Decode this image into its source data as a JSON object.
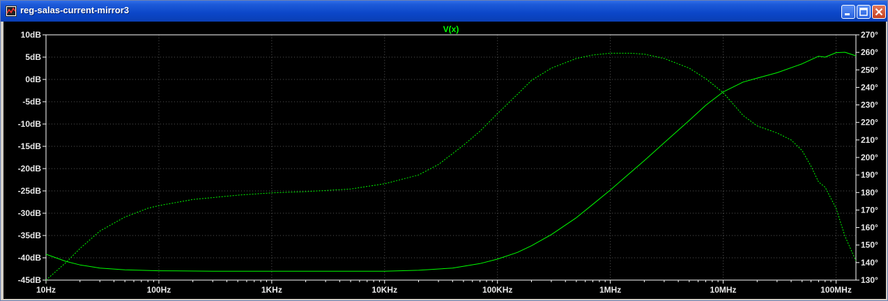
{
  "window": {
    "title": "reg-salas-current-mirror3",
    "icon": "waveform-icon",
    "buttons": [
      "minimize-icon",
      "maximize-icon",
      "close-icon"
    ]
  },
  "colors": {
    "trace": "#00ff00",
    "background": "#000000",
    "axis": "#ffffff",
    "grid": "#555555"
  },
  "chart_data": {
    "type": "line",
    "legend": "V(x)",
    "x_scale": "log",
    "xlim": [
      10,
      150000000
    ],
    "x_ticks": [
      {
        "value": 10,
        "label": "10Hz"
      },
      {
        "value": 100,
        "label": "100Hz"
      },
      {
        "value": 1000,
        "label": "1KHz"
      },
      {
        "value": 10000,
        "label": "10KHz"
      },
      {
        "value": 100000,
        "label": "100KHz"
      },
      {
        "value": 1000000,
        "label": "1MHz"
      },
      {
        "value": 10000000,
        "label": "10MHz"
      },
      {
        "value": 100000000,
        "label": "100MHz"
      }
    ],
    "y_left": {
      "ylim": [
        -45,
        10
      ],
      "ticks": [
        {
          "value": 10,
          "label": "10dB"
        },
        {
          "value": 5,
          "label": "5dB"
        },
        {
          "value": 0,
          "label": "0dB"
        },
        {
          "value": -5,
          "label": "-5dB"
        },
        {
          "value": -10,
          "label": "-10dB"
        },
        {
          "value": -15,
          "label": "-15dB"
        },
        {
          "value": -20,
          "label": "-20dB"
        },
        {
          "value": -25,
          "label": "-25dB"
        },
        {
          "value": -30,
          "label": "-30dB"
        },
        {
          "value": -35,
          "label": "-35dB"
        },
        {
          "value": -40,
          "label": "-40dB"
        },
        {
          "value": -45,
          "label": "-45dB"
        }
      ]
    },
    "y_right": {
      "ylim": [
        130,
        270
      ],
      "ticks": [
        {
          "value": 270,
          "label": "270°"
        },
        {
          "value": 260,
          "label": "260°"
        },
        {
          "value": 250,
          "label": "250°"
        },
        {
          "value": 240,
          "label": "240°"
        },
        {
          "value": 230,
          "label": "230°"
        },
        {
          "value": 220,
          "label": "220°"
        },
        {
          "value": 210,
          "label": "210°"
        },
        {
          "value": 200,
          "label": "200°"
        },
        {
          "value": 190,
          "label": "190°"
        },
        {
          "value": 180,
          "label": "180°"
        },
        {
          "value": 170,
          "label": "170°"
        },
        {
          "value": 160,
          "label": "160°"
        },
        {
          "value": 150,
          "label": "150°"
        },
        {
          "value": 140,
          "label": "140°"
        },
        {
          "value": 130,
          "label": "130°"
        }
      ]
    },
    "series": [
      {
        "axis": "left",
        "style": "solid",
        "points": [
          [
            10,
            -39.2
          ],
          [
            15,
            -40.8
          ],
          [
            20,
            -41.6
          ],
          [
            30,
            -42.3
          ],
          [
            50,
            -42.7
          ],
          [
            100,
            -42.9
          ],
          [
            300,
            -43.0
          ],
          [
            1000,
            -43.0
          ],
          [
            3000,
            -43.0
          ],
          [
            10000,
            -43.0
          ],
          [
            20000,
            -42.8
          ],
          [
            40000,
            -42.3
          ],
          [
            70000,
            -41.3
          ],
          [
            100000,
            -40.3
          ],
          [
            150000,
            -38.8
          ],
          [
            200000,
            -37.3
          ],
          [
            300000,
            -34.8
          ],
          [
            500000,
            -31.0
          ],
          [
            700000,
            -28.0
          ],
          [
            1000000,
            -24.8
          ],
          [
            2000000,
            -18.2
          ],
          [
            3000000,
            -14.2
          ],
          [
            5000000,
            -9.2
          ],
          [
            7000000,
            -5.8
          ],
          [
            10000000,
            -2.8
          ],
          [
            15000000,
            -0.6
          ],
          [
            20000000,
            0.3
          ],
          [
            30000000,
            1.5
          ],
          [
            50000000,
            3.5
          ],
          [
            70000000,
            5.2
          ],
          [
            80000000,
            5.0
          ],
          [
            100000000,
            6.0
          ],
          [
            120000000,
            6.1
          ],
          [
            150000000,
            5.3
          ]
        ]
      },
      {
        "axis": "right",
        "style": "dashed",
        "points": [
          [
            10,
            130
          ],
          [
            15,
            140
          ],
          [
            20,
            148
          ],
          [
            30,
            158
          ],
          [
            50,
            166
          ],
          [
            80,
            171
          ],
          [
            100,
            172.5
          ],
          [
            200,
            176
          ],
          [
            500,
            178.5
          ],
          [
            1000,
            179.8
          ],
          [
            2000,
            180.5
          ],
          [
            5000,
            182
          ],
          [
            10000,
            185
          ],
          [
            20000,
            190
          ],
          [
            30000,
            196
          ],
          [
            50000,
            207
          ],
          [
            70000,
            215
          ],
          [
            100000,
            225
          ],
          [
            150000,
            236
          ],
          [
            200000,
            244
          ],
          [
            300000,
            251
          ],
          [
            500000,
            256.5
          ],
          [
            700000,
            258.5
          ],
          [
            1000000,
            259.5
          ],
          [
            1500000,
            259.5
          ],
          [
            2000000,
            259
          ],
          [
            3000000,
            256.5
          ],
          [
            5000000,
            251
          ],
          [
            7000000,
            245
          ],
          [
            10000000,
            237
          ],
          [
            15000000,
            224
          ],
          [
            20000000,
            218
          ],
          [
            30000000,
            214
          ],
          [
            40000000,
            210
          ],
          [
            50000000,
            204
          ],
          [
            60000000,
            195
          ],
          [
            70000000,
            186
          ],
          [
            80000000,
            183
          ],
          [
            100000000,
            171
          ],
          [
            120000000,
            155
          ],
          [
            150000000,
            141
          ]
        ]
      }
    ]
  }
}
